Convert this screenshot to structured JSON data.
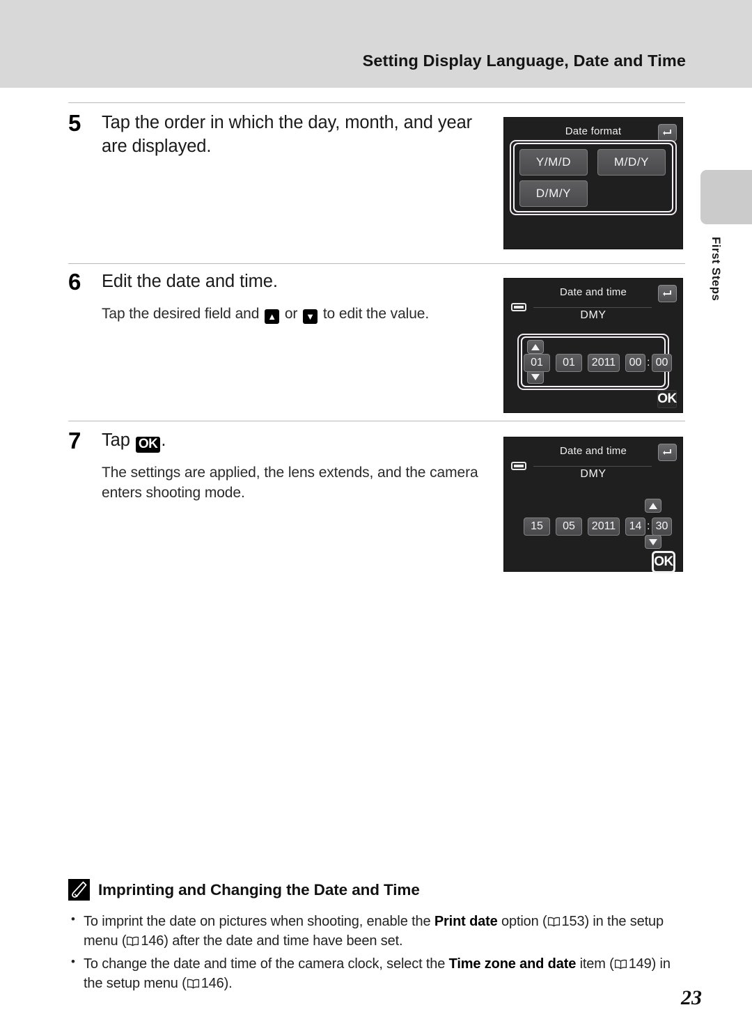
{
  "header": {
    "title": "Setting Display Language, Date and Time"
  },
  "side_tab": {
    "label": "First Steps"
  },
  "steps": [
    {
      "number": "5",
      "title": "Tap the order in which the day, month, and year are displayed.",
      "sub": ""
    },
    {
      "number": "6",
      "title": "Edit the date and time.",
      "sub_before": "Tap the desired field and",
      "sub_middle": "or",
      "sub_after": "to edit the value.",
      "up_icon": "up-triangle-icon",
      "down_icon": "down-triangle-icon"
    },
    {
      "number": "7",
      "title_before": "Tap",
      "title_badge": "OK",
      "title_after": ".",
      "sub": "The settings are applied, the lens extends, and the camera enters shooting mode."
    }
  ],
  "screens": {
    "date_format": {
      "title": "Date format",
      "back_icon": "back-arrow-icon",
      "options": [
        "Y/M/D",
        "M/D/Y",
        "D/M/Y"
      ]
    },
    "date_time_initial": {
      "title": "Date and time",
      "back_icon": "back-arrow-icon",
      "battery_icon": "battery-icon",
      "format_label": "DMY",
      "fields": {
        "day": "01",
        "month": "01",
        "year": "2011",
        "hour": "00",
        "minute": "00",
        "separator": ":"
      },
      "up_icon": "up-triangle-icon",
      "down_icon": "down-triangle-icon",
      "ok_label": "OK"
    },
    "date_time_edited": {
      "title": "Date and time",
      "back_icon": "back-arrow-icon",
      "battery_icon": "battery-icon",
      "format_label": "DMY",
      "fields": {
        "day": "15",
        "month": "05",
        "year": "2011",
        "hour": "14",
        "minute": "30",
        "separator": ":"
      },
      "up_icon": "up-triangle-icon",
      "down_icon": "down-triangle-icon",
      "ok_label": "OK"
    }
  },
  "note": {
    "icon": "pencil-note-icon",
    "title": "Imprinting and Changing the Date and Time",
    "bullets": [
      {
        "part1": "To imprint the date on pictures when shooting, enable the ",
        "bold1": "Print date",
        "part2": " option (",
        "ref1": "153",
        "part3": ") in the setup menu (",
        "ref2": "146",
        "part4": ") after the date and time have been set."
      },
      {
        "part1": "To change the date and time of the camera clock, select the ",
        "bold1": "Time zone and date",
        "part2": " item (",
        "ref1": "149",
        "part3": ") in the setup menu (",
        "ref2": "146",
        "part4": ")."
      }
    ]
  },
  "page_number": "23",
  "colors": {
    "header_band": "#d8d8d8",
    "side_tab": "#cbcbcb",
    "lcd_background": "#1f1f1f",
    "lcd_button": "#565658",
    "rule": "#b9b9b9"
  }
}
